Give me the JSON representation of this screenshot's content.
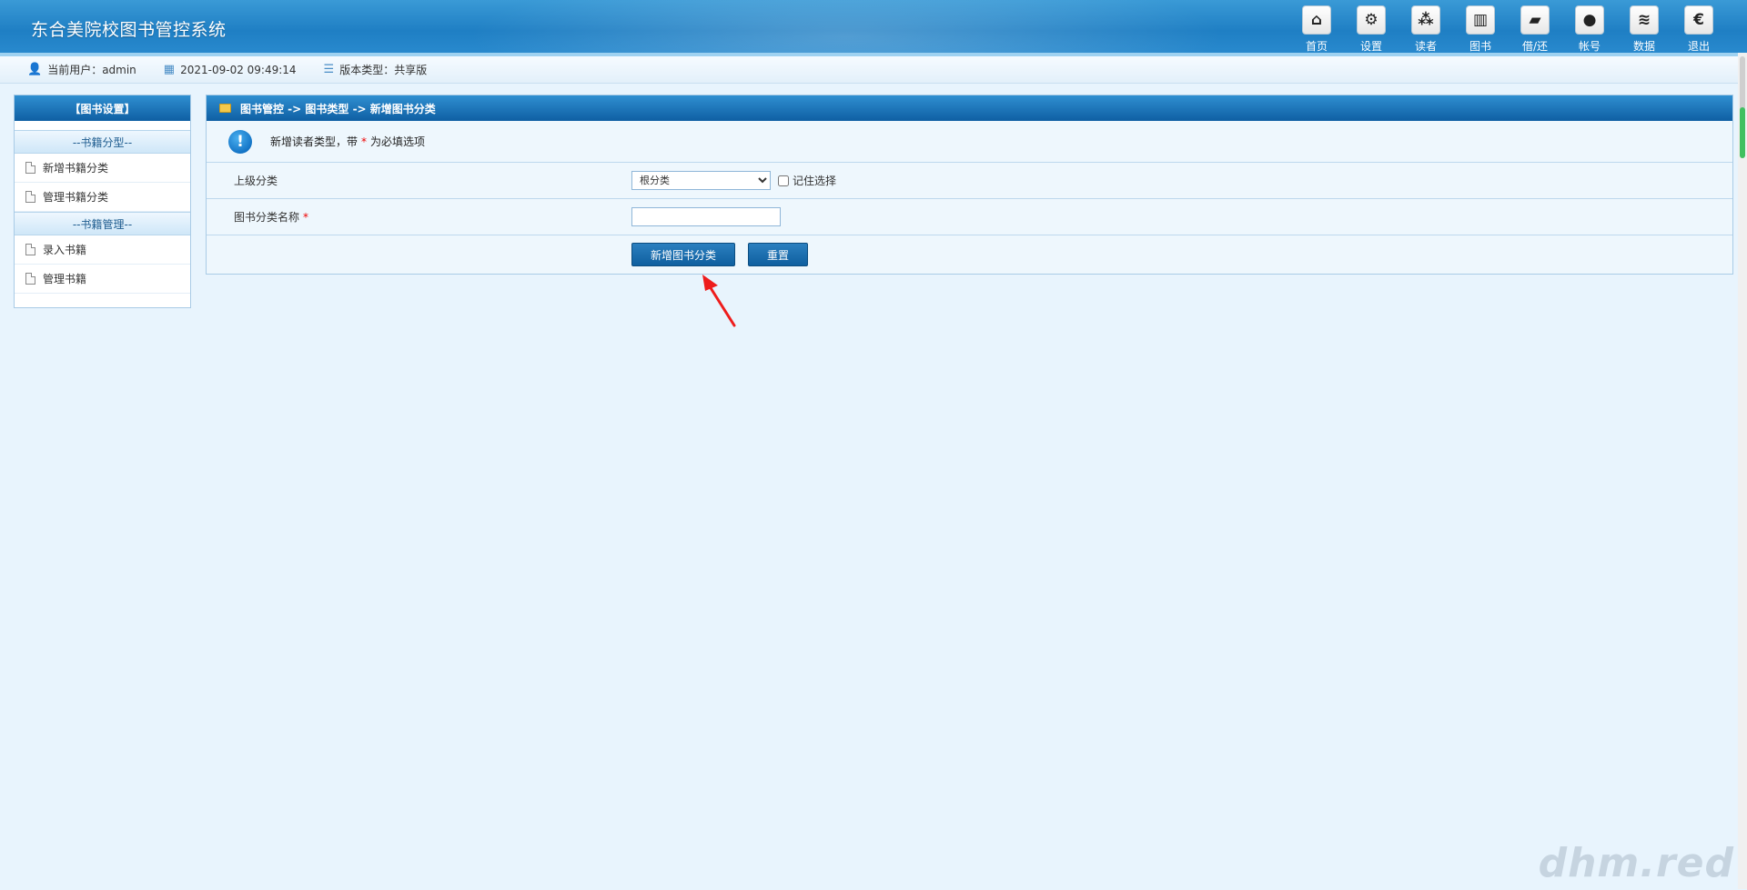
{
  "header": {
    "title": "东合美院校图书管控系统",
    "nav": [
      {
        "label": "首页",
        "icon": "home-icon",
        "glyph": "⌂"
      },
      {
        "label": "设置",
        "icon": "settings-icon",
        "glyph": "⚙"
      },
      {
        "label": "读者",
        "icon": "readers-icon",
        "glyph": "⁂"
      },
      {
        "label": "图书",
        "icon": "book-icon",
        "glyph": "▥"
      },
      {
        "label": "借/还",
        "icon": "folder-icon",
        "glyph": "▰"
      },
      {
        "label": "帐号",
        "icon": "account-icon",
        "glyph": "●"
      },
      {
        "label": "数据",
        "icon": "database-icon",
        "glyph": "≋"
      },
      {
        "label": "退出",
        "icon": "logout-icon",
        "glyph": "€"
      }
    ]
  },
  "status": {
    "user": "当前用户：admin",
    "datetime": "2021-09-02 09:49:14",
    "version": "版本类型：共享版"
  },
  "sidebar": {
    "title": "【图书设置】",
    "group1": "--书籍分型--",
    "group1_items": [
      "新增书籍分类",
      "管理书籍分类"
    ],
    "group2": "--书籍管理--",
    "group2_items": [
      "录入书籍",
      "管理书籍"
    ]
  },
  "main": {
    "breadcrumb": "图书管控 -> 图书类型 -> 新增图书分类",
    "notice_prefix": "新增读者类型，带",
    "notice_star": "*",
    "notice_suffix": "为必填选项",
    "parent_label": "上级分类",
    "parent_selected": "根分类",
    "remember_label": "记住选择",
    "name_label": "图书分类名称",
    "name_star": "*",
    "name_value": "",
    "submit_label": "新增图书分类",
    "reset_label": "重置"
  },
  "colors": {
    "header_blue": "#1f7fc4",
    "panel_head": "#0f5fa3",
    "background": "#e8f4fd",
    "annotation_red": "#ee1c1c"
  },
  "watermark": "dhm.red"
}
